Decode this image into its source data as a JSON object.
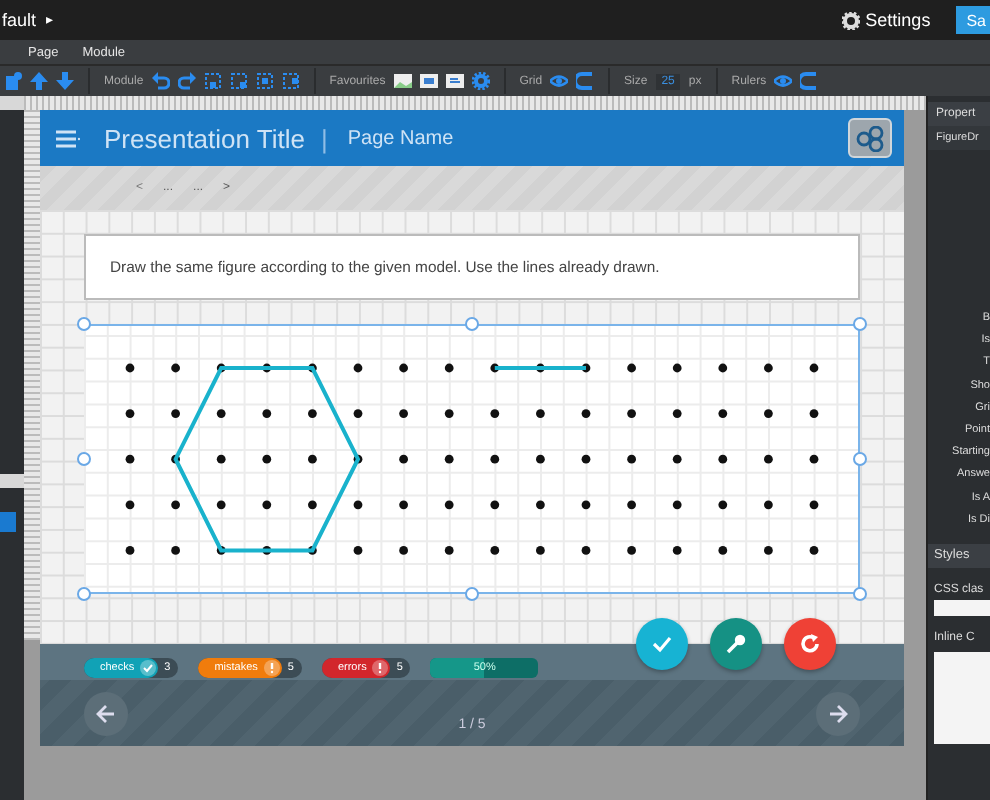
{
  "topbar": {
    "project": "fault",
    "project_caret": "▸",
    "settings": "Settings",
    "save": "Sa"
  },
  "menu": [
    {
      "label": "Page"
    },
    {
      "label": "Module"
    }
  ],
  "toolbar": {
    "module_label": "Module",
    "favourites_label": "Favourites",
    "grid_label": "Grid",
    "size_label": "Size",
    "size_value": "25",
    "size_unit": "px",
    "rulers_label": "Rulers"
  },
  "presentation": {
    "title": "Presentation Title",
    "separator": "|",
    "page_name": "Page Name"
  },
  "breadcrumb": [
    {
      "label": "<",
      "kind": "prev"
    },
    {
      "label": "...",
      "kind": "item"
    },
    {
      "label": "...",
      "kind": "item"
    },
    {
      "label": ">",
      "kind": "next"
    }
  ],
  "instruction": "Draw the same figure according to the given model. Use the lines already drawn.",
  "counters": [
    {
      "kind": "checks",
      "label": "checks",
      "count": "3",
      "color": "#11a2b6"
    },
    {
      "kind": "mistakes",
      "label": "mistakes",
      "count": "5",
      "color": "#f07c0c"
    },
    {
      "kind": "errors",
      "label": "errors",
      "count": "5",
      "color": "#d2262c"
    }
  ],
  "progress": {
    "label": "50%",
    "level": 0.5
  },
  "actions": [
    {
      "kind": "check",
      "color": "#17b3d3"
    },
    {
      "kind": "key",
      "color": "#159184"
    },
    {
      "kind": "reset",
      "color": "#ef4136"
    }
  ],
  "pager": "1 / 5",
  "properties": {
    "tab": "Propert",
    "module": "FigureDr",
    "labels": [
      "B",
      "Is",
      "T",
      "Sho",
      "Gri",
      "Point",
      "Starting",
      "Answe",
      "Is A",
      "Is Di"
    ],
    "styles_tab": "Styles",
    "css_label": "CSS clas",
    "inline_label": "Inline C"
  }
}
